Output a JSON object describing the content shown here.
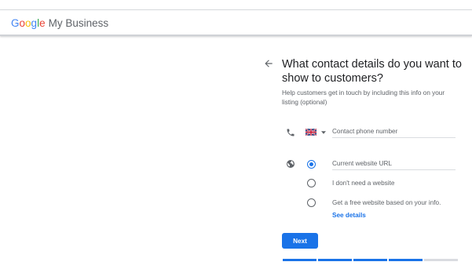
{
  "brand": {
    "letters": [
      "G",
      "o",
      "o",
      "g",
      "l",
      "e"
    ],
    "product": "My Business",
    "colors": {
      "blue": "#4285f4",
      "red": "#ea4335",
      "yellow": "#fbbc05",
      "green": "#34a853"
    }
  },
  "header": {
    "back_icon": "arrow-left-icon"
  },
  "main": {
    "title": "What contact details do you want to show to customers?",
    "subtitle": "Help customers get in touch by including this info on your listing (optional)"
  },
  "phone": {
    "icon": "phone-icon",
    "country_flag": "uk-flag-icon",
    "placeholder": "Contact phone number",
    "value": ""
  },
  "website": {
    "icon": "globe-icon",
    "options": [
      {
        "label": "Current website URL",
        "checked": true,
        "kind": "input"
      },
      {
        "label": "I don't need a website",
        "checked": false
      },
      {
        "label": "Get a free website based on your info.",
        "checked": false
      }
    ],
    "see_details": "See details"
  },
  "actions": {
    "next_label": "Next",
    "accent": "#1a73e8"
  },
  "progress": {
    "total_steps": 5,
    "completed_steps": 4
  }
}
